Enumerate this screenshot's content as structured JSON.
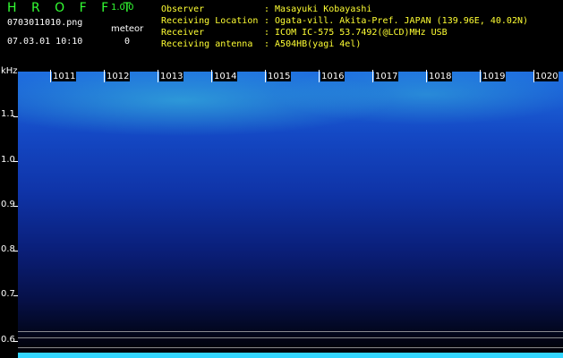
{
  "header": {
    "app_title": "H R O F F T",
    "app_version": "1.0.0",
    "filename": "0703011010.png",
    "meteor_label": "meteor",
    "datetime": "07.03.01 10:10",
    "meteor_count": "0"
  },
  "info": [
    {
      "key": "Observer",
      "value": ": Masayuki Kobayashi"
    },
    {
      "key": "Receiving Location",
      "value": ": Ogata-vill. Akita-Pref. JAPAN (139.96E, 40.02N)"
    },
    {
      "key": "Receiver",
      "value": ": ICOM IC-575 53.7492(@LCD)MHz USB"
    },
    {
      "key": "Receiving antenna",
      "value": ": A504HB(yagi 4el)"
    }
  ],
  "y_axis": {
    "unit": "kHz",
    "ticks": [
      "1.1",
      "1.0",
      "0.9",
      "0.8",
      "0.7",
      "0.6"
    ]
  },
  "x_axis": {
    "ticks": [
      "1011",
      "1012",
      "1013",
      "1014",
      "1015",
      "1016",
      "1017",
      "1018",
      "1019",
      "1020"
    ]
  },
  "colors": {
    "title_green": "#33ff33",
    "info_yellow": "#ffff33",
    "spectrum_high": "#3cc8dc",
    "spectrum_mid": "#1448c4",
    "baseline_cyan": "#33d6ff"
  }
}
